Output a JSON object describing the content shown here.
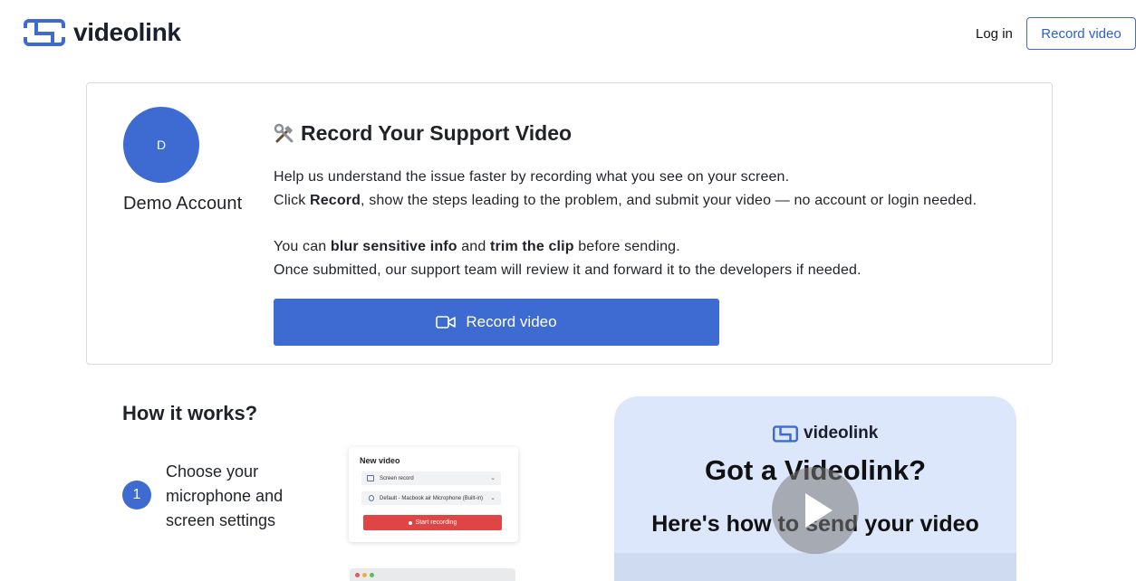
{
  "header": {
    "brand": "videolink",
    "login_label": "Log in",
    "record_label": "Record video"
  },
  "card": {
    "avatar_initial": "D",
    "account_name": "Demo Account",
    "title": "Record Your Support Video",
    "para1_line1": "Help us understand the issue faster by recording what you see on your screen.",
    "para1_line2_a": "Click ",
    "para1_line2_b": "Record",
    "para1_line2_c": ", show the steps leading to the problem, and submit your video — no account or login needed.",
    "para2_line1_a": "You can ",
    "para2_line1_b": "blur sensitive info",
    "para2_line1_c": " and ",
    "para2_line1_d": "trim the clip",
    "para2_line1_e": " before sending.",
    "para2_line2": "Once submitted, our support team will review it and forward it to the developers if needed.",
    "record_button_label": "Record video"
  },
  "how_it_works": {
    "title": "How it works?",
    "steps": [
      {
        "number": "1",
        "text": "Choose your microphone and screen settings"
      }
    ]
  },
  "mockup": {
    "title": "New video",
    "screen_option": "Screen record",
    "mic_option": "Default - Macbook air Microphone (Built-in)",
    "start_label": "Start recording"
  },
  "promo_video": {
    "brand": "videolink",
    "headline": "Got a Videolink?",
    "subheadline": "Here's how to send your video"
  },
  "colors": {
    "brand_blue": "#3d6bd1",
    "promo_bg": "#dde7fb",
    "start_red": "#e04545"
  },
  "icons": [
    "logo-mark-icon",
    "tools-icon",
    "video-camera-icon",
    "play-icon"
  ]
}
